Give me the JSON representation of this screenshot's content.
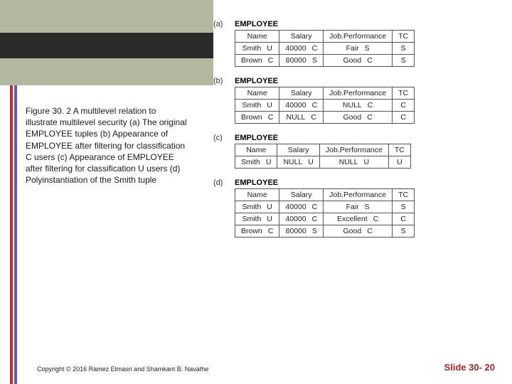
{
  "caption": "Figure 30. 2 A multilevel relation to illustrate multilevel security (a) The original EMPLOYEE tuples (b) Appearance of EMPLOYEE after filtering for classification C users (c) Appearance of EMPLOYEE after filtering for classification U users (d) Polyinstantiation of the Smith tuple",
  "footer": "Copyright © 2016 Ramez Elmasri and Shamkant B. Navathe",
  "slidenum": "Slide 30- 20",
  "tables": [
    {
      "label": "(a)",
      "title": "EMPLOYEE",
      "headers": [
        "Name",
        "Salary",
        "Job.Performance",
        "TC"
      ],
      "rows": [
        [
          [
            "Smith",
            "U"
          ],
          [
            "40000",
            "C"
          ],
          [
            "Fair",
            "S"
          ],
          [
            "S"
          ]
        ],
        [
          [
            "Brown",
            "C"
          ],
          [
            "80000",
            "S"
          ],
          [
            "Good",
            "C"
          ],
          [
            "S"
          ]
        ]
      ]
    },
    {
      "label": "(b)",
      "title": "EMPLOYEE",
      "headers": [
        "Name",
        "Salary",
        "Job.Performance",
        "TC"
      ],
      "rows": [
        [
          [
            "Smith",
            "U"
          ],
          [
            "40000",
            "C"
          ],
          [
            "NULL",
            "C"
          ],
          [
            "C"
          ]
        ],
        [
          [
            "Brown",
            "C"
          ],
          [
            "NULL",
            "C"
          ],
          [
            "Good",
            "C"
          ],
          [
            "C"
          ]
        ]
      ]
    },
    {
      "label": "(c)",
      "title": "EMPLOYEE",
      "headers": [
        "Name",
        "Salary",
        "Job.Performance",
        "TC"
      ],
      "rows": [
        [
          [
            "Smith",
            "U"
          ],
          [
            "NULL",
            "U"
          ],
          [
            "NULL",
            "U"
          ],
          [
            "U"
          ]
        ]
      ]
    },
    {
      "label": "(d)",
      "title": "EMPLOYEE",
      "headers": [
        "Name",
        "Salary",
        "Job.Performance",
        "TC"
      ],
      "rows": [
        [
          [
            "Smith",
            "U"
          ],
          [
            "40000",
            "C"
          ],
          [
            "Fair",
            "S"
          ],
          [
            "S"
          ]
        ],
        [
          [
            "Smith",
            "U"
          ],
          [
            "40000",
            "C"
          ],
          [
            "Excellent",
            "C"
          ],
          [
            "C"
          ]
        ],
        [
          [
            "Brown",
            "C"
          ],
          [
            "80000",
            "S"
          ],
          [
            "Good",
            "C"
          ],
          [
            "S"
          ]
        ]
      ]
    }
  ]
}
